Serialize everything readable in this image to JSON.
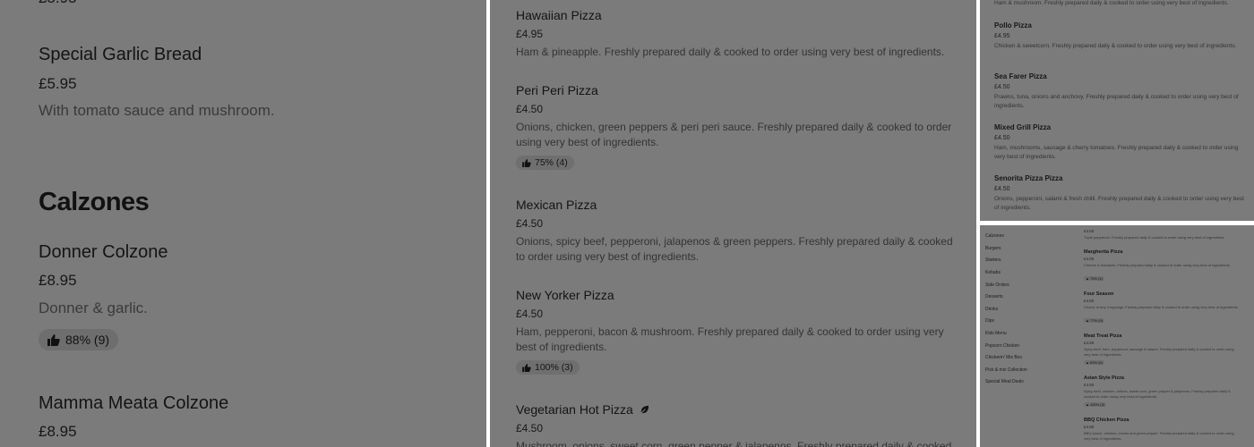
{
  "panel1": {
    "garlic_bread": {
      "name": "Special Garlic Bread",
      "price": "£5.95",
      "desc": "With tomato sauce and mushroom."
    },
    "section_calzones": "Calzones",
    "donner": {
      "name": "Donner Colzone",
      "price": "£8.95",
      "desc": "Donner & garlic.",
      "rating": "88% (9)"
    },
    "mamma": {
      "name": "Mamma Meata Colzone",
      "price": "£8.95"
    }
  },
  "panel2": {
    "items": [
      {
        "name": "Hawaiian Pizza",
        "price": "£4.95",
        "desc": "Ham & pineapple. Freshly prepared daily & cooked to order using very best of ingredients."
      },
      {
        "name": "Peri Peri Pizza",
        "price": "£4.50",
        "desc": "Onions, chicken, green peppers & peri peri sauce. Freshly prepared daily & cooked to order using very best of ingredients.",
        "rating": "75% (4)"
      },
      {
        "name": "Mexican Pizza",
        "price": "£4.50",
        "desc": "Onions, spicy beef, pepperoni, jalapenos & green peppers. Freshly prepared daily & cooked to order using very best of ingredients."
      },
      {
        "name": "New Yorker Pizza",
        "price": "£4.50",
        "desc": "Ham, pepperoni, bacon & mushroom. Freshly prepared daily & cooked to order using very best of ingredients.",
        "rating": "100% (3)"
      },
      {
        "name": "Vegetarian Hot Pizza",
        "price": "£4.50",
        "desc": "Mushroom, onions, sweet corn, green pepper & jalapenos. Freshly prepared daily & cooked"
      }
    ]
  },
  "panel3": {
    "top_desc": "Ham & mushroom. Freshly prepared daily & cooked to order using very best of ingredients.",
    "items": [
      {
        "name": "Pollo Pizza",
        "price": "£4.95",
        "desc": "Chicken & sweetcorn. Freshly prepared daily & cooked to order using very best of ingredients."
      },
      {
        "name": "Sea Farer Pizza",
        "price": "£4.50",
        "desc": "Prawns, tuna, onions and anchovy. Freshly prepared daily & cooked to order using very best of ingredients."
      },
      {
        "name": "Mixed Grill Pizza",
        "price": "£4.50",
        "desc": "Ham, mushrooms, sausage & cherry tomatoes. Freshly prepared daily & cooked to order using very best of ingredients."
      },
      {
        "name": "Senorita Pizza Pizza",
        "price": "£4.50",
        "desc": "Onions, pepperoni, salami & fresh chilli. Freshly prepared daily & cooked to order using very best of ingredients."
      }
    ]
  },
  "panel4": {
    "categories": [
      "Calzones",
      "Burgers",
      "Starters",
      "Kebabs",
      "Side Orders",
      "Desserts",
      "Drinks",
      "Dips",
      "Kids Menu",
      "Popcorn Chicken",
      "Chickerin' Mix Box",
      "Pick & mix Collection",
      "Special Meal Deals"
    ],
    "top": {
      "price": "£4.50",
      "desc": "Triple pepperoni. Freshly prepared daily & cooked to order using very best of ingredients."
    },
    "items": [
      {
        "name": "Margherita Pizza",
        "price": "£4.00",
        "desc": "Cheese & tomatoes. Freshly prepared daily & cooked to order using very best of ingredients.",
        "rating": "75% (4)"
      },
      {
        "name": "Four Season",
        "price": "£4.50",
        "desc": "Choice of any 4 toppings. Freshly prepared daily & cooked to order using very best of ingredients.",
        "rating": "77% (9)"
      },
      {
        "name": "Meat Treat Pizza",
        "price": "£4.50",
        "desc": "Spicy beef, ham, pepperoni, sausage & salami. Freshly prepared daily & cooked to order using very best of ingredients.",
        "rating": "83% (6)"
      },
      {
        "name": "Asian Style Pizza",
        "price": "£4.50",
        "desc": "Spicy beef, chicken, onions, sweet corn, green pepper & jalapenos. Freshly prepared daily & cooked to order using very best of ingredients.",
        "rating": "100% (3)"
      },
      {
        "name": "BBQ Chicken Pizza",
        "price": "£4.50",
        "desc": "BBQ sauce, chicken, onions and green pepper. Freshly prepared daily & cooked to order using very best of ingredients."
      }
    ]
  }
}
